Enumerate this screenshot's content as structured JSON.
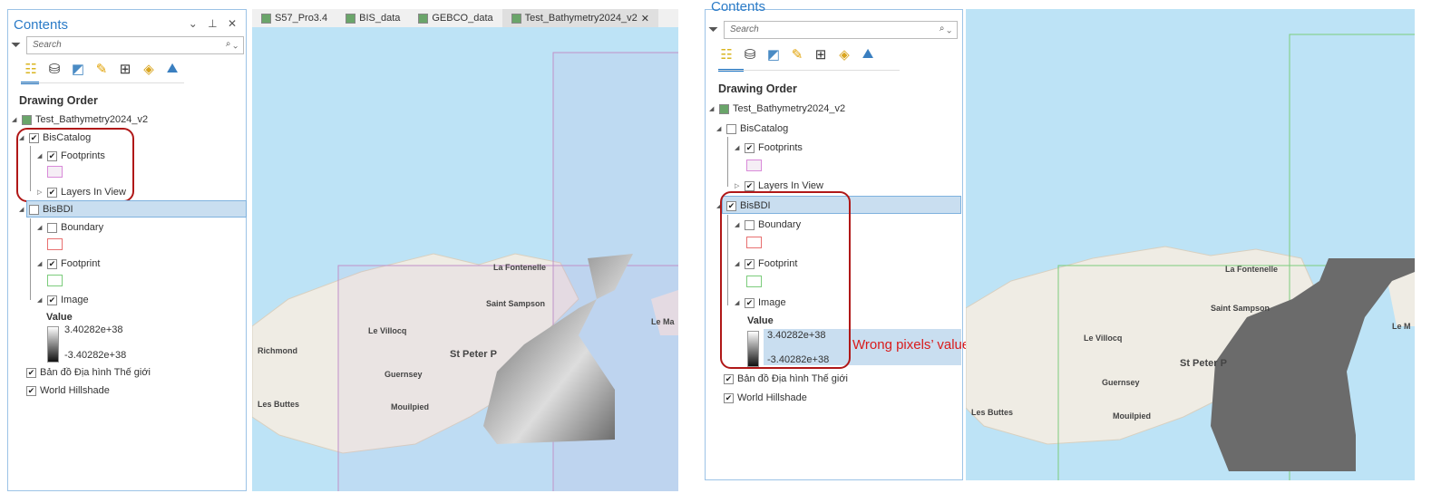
{
  "left": {
    "panel": {
      "title": "Contents",
      "controls": "⌄ ⊥ ✕",
      "search_placeholder": "Search",
      "heading": "Drawing Order",
      "map_name": "Test_Bathymetry2024_v2",
      "layers": {
        "biscatalog": "BisCatalog",
        "footprints": "Footprints",
        "layers_in_view": "Layers In View",
        "bisbdi": "BisBDI",
        "boundary": "Boundary",
        "footprint": "Footprint",
        "image": "Image",
        "value": "Value",
        "max": "3.40282e+38",
        "min": "-3.40282e+38",
        "basemap": "Bản đồ Địa hình Thế giới",
        "hillshade": "World Hillshade"
      }
    },
    "tabs": [
      "S57_Pro3.4",
      "BIS_data",
      "GEBCO_data",
      "Test_Bathymetry2024_v2"
    ],
    "tab_close": "✕",
    "map_labels": [
      "La Fontenelle",
      "Saint Sampson",
      "Le Villocq",
      "Richmond",
      "Guernsey",
      "St Peter P",
      "Les Buttes",
      "Mouilpied",
      "Le Ma"
    ]
  },
  "right": {
    "panel": {
      "title": "Contents",
      "search_placeholder": "Search",
      "heading": "Drawing Order"
    },
    "map_labels": [
      "La Fontenelle",
      "Saint Sampson",
      "Le Villocq",
      "Guernsey",
      "St Peter P",
      "Les Buttes",
      "Mouilpied",
      "Le M"
    ],
    "annotation": "Wrong pixels’ value"
  },
  "colors": {
    "annotation": "#d91c1c",
    "accent": "#2b7bc7",
    "water": "#bde3f6"
  }
}
